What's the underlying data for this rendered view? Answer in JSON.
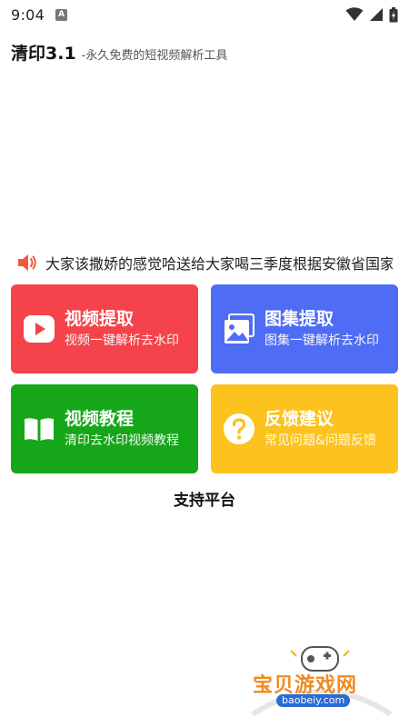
{
  "status_bar": {
    "time": "9:04",
    "notification_letter": "A"
  },
  "header": {
    "title": "清印3.1",
    "subtitle": "-永久免费的短视频解析工具"
  },
  "notice": {
    "text": "大家该撒娇的感觉哈送给大家喝三季度根据安徽省国家队",
    "icon": "speaker-icon"
  },
  "cards": [
    {
      "title": "视频提取",
      "desc": "视频一键解析去水印",
      "color": "#f4434a",
      "icon": "play-icon"
    },
    {
      "title": "图集提取",
      "desc": "图集一键解析去水印",
      "color": "#4f6cf4",
      "icon": "image-icon"
    },
    {
      "title": "视频教程",
      "desc": "清印去水印视频教程",
      "color": "#16a619",
      "icon": "book-icon"
    },
    {
      "title": "反馈建议",
      "desc": "常见问题&问题反馈",
      "color": "#fcc21d",
      "icon": "question-icon"
    }
  ],
  "support": {
    "title": "支持平台"
  },
  "watermark": {
    "text": "宝贝游戏网",
    "url": "baobeiy.com"
  }
}
